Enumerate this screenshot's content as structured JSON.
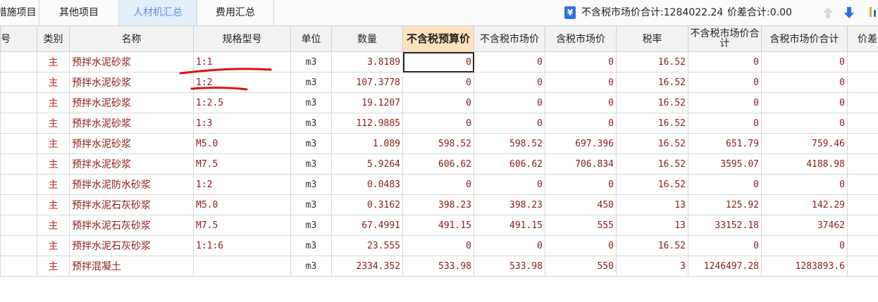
{
  "tabs": [
    {
      "label": "措施项目",
      "active": false
    },
    {
      "label": "其他项目",
      "active": false
    },
    {
      "label": "人材机汇总",
      "active": true
    },
    {
      "label": "费用汇总",
      "active": false
    }
  ],
  "toolbar": {
    "tax_icon": "¥",
    "total_label": "不含税市场价合计:1284022.24",
    "diff_label": "价差合计:0.00"
  },
  "columns": [
    "号",
    "类别",
    "名称",
    "规格型号",
    "单位",
    "数量",
    "不含税预算价",
    "不含税市场价",
    "含税市场价",
    "税率",
    "不含税市场价合计",
    "含税市场价合计",
    "价差"
  ],
  "rows": [
    {
      "type": "主",
      "name": "预拌水泥砂浆",
      "spec": "1:1",
      "unit": "m3",
      "qty": "3.8189",
      "budget": "0",
      "market": "0",
      "market_tax": "0",
      "rate": "16.52",
      "total": "0",
      "total_tax": "0"
    },
    {
      "type": "主",
      "name": "预拌水泥砂浆",
      "spec": "1:2",
      "unit": "m3",
      "qty": "107.3778",
      "budget": "0",
      "market": "0",
      "market_tax": "0",
      "rate": "16.52",
      "total": "0",
      "total_tax": "0"
    },
    {
      "type": "主",
      "name": "预拌水泥砂浆",
      "spec": "1:2.5",
      "unit": "m3",
      "qty": "19.1207",
      "budget": "0",
      "market": "0",
      "market_tax": "0",
      "rate": "16.52",
      "total": "0",
      "total_tax": "0"
    },
    {
      "type": "主",
      "name": "预拌水泥砂浆",
      "spec": "1:3",
      "unit": "m3",
      "qty": "112.9885",
      "budget": "0",
      "market": "0",
      "market_tax": "0",
      "rate": "16.52",
      "total": "0",
      "total_tax": "0"
    },
    {
      "type": "主",
      "name": "预拌水泥砂浆",
      "spec": "M5.0",
      "unit": "m3",
      "qty": "1.089",
      "budget": "598.52",
      "market": "598.52",
      "market_tax": "697.396",
      "rate": "16.52",
      "total": "651.79",
      "total_tax": "759.46"
    },
    {
      "type": "主",
      "name": "预拌水泥砂浆",
      "spec": "M7.5",
      "unit": "m3",
      "qty": "5.9264",
      "budget": "606.62",
      "market": "606.62",
      "market_tax": "706.834",
      "rate": "16.52",
      "total": "3595.07",
      "total_tax": "4188.98"
    },
    {
      "type": "主",
      "name": "预拌水泥防水砂浆",
      "spec": "1:2",
      "unit": "m3",
      "qty": "0.0483",
      "budget": "0",
      "market": "0",
      "market_tax": "0",
      "rate": "16.52",
      "total": "0",
      "total_tax": "0"
    },
    {
      "type": "主",
      "name": "预拌水泥石灰砂浆",
      "spec": "M5.0",
      "unit": "m3",
      "qty": "0.3162",
      "budget": "398.23",
      "market": "398.23",
      "market_tax": "450",
      "rate": "13",
      "total": "125.92",
      "total_tax": "142.29"
    },
    {
      "type": "主",
      "name": "预拌水泥石灰砂浆",
      "spec": "M7.5",
      "unit": "m3",
      "qty": "67.4991",
      "budget": "491.15",
      "market": "491.15",
      "market_tax": "555",
      "rate": "13",
      "total": "33152.18",
      "total_tax": "37462"
    },
    {
      "type": "主",
      "name": "预拌水泥石灰砂浆",
      "spec": "1:1:6",
      "unit": "m3",
      "qty": "23.555",
      "budget": "0",
      "market": "0",
      "market_tax": "0",
      "rate": "16.52",
      "total": "0",
      "total_tax": "0"
    },
    {
      "type": "主",
      "name": "预拌混凝土",
      "spec": "",
      "unit": "m3",
      "qty": "2334.352",
      "budget": "533.98",
      "market": "533.98",
      "market_tax": "550",
      "rate": "3",
      "total": "1246497.28",
      "total_tax": "1283893.6"
    }
  ],
  "colors": {
    "accent": "#2e73d8",
    "header_highlight": "#fde3bd",
    "annotation": "#e01010",
    "data_text": "#8b1c1c"
  },
  "icons": {
    "sort_up": "arrow-up-icon",
    "sort_down": "arrow-down-icon",
    "tax": "yuan-tag-icon"
  }
}
